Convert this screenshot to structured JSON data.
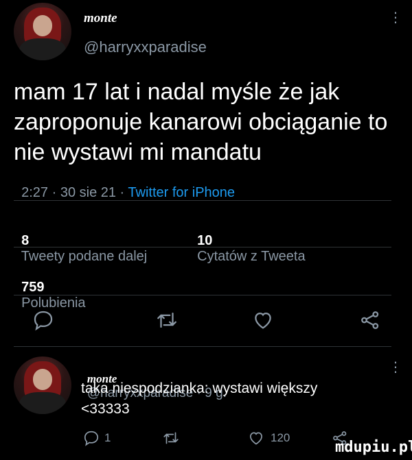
{
  "tweet": {
    "author_name": "monte",
    "author_handle": "@harryxxparadise",
    "text_line1": "mam 17 lat i nadal myśle że jak",
    "text_line2": "zaproponuje kanarowi obciąganie to",
    "text_line3": "nie wystawi mi mandatu",
    "meta_time": "2:27 · 30 sie 21 · ",
    "meta_source": "Twitter for iPhone"
  },
  "stats": {
    "retweets_count": "8",
    "retweets_label": "Tweety podane dalej",
    "quotes_count": "10",
    "quotes_label": "Cytatów z Tweeta",
    "likes_count": "759",
    "likes_label": "Polubienia"
  },
  "reply": {
    "author_name": "monte",
    "author_handle": "@harryxxparadise · 9 g.",
    "text_line1": "taka niespodzianka: wystawi większy",
    "text_line2": "<33333",
    "reply_count": "1",
    "like_count": "120"
  },
  "watermark": "mdupiu.pl",
  "colors": {
    "background": "#000000",
    "secondary_text": "#8b98a5",
    "link": "#1d9bf0",
    "divider": "#2f3336"
  }
}
